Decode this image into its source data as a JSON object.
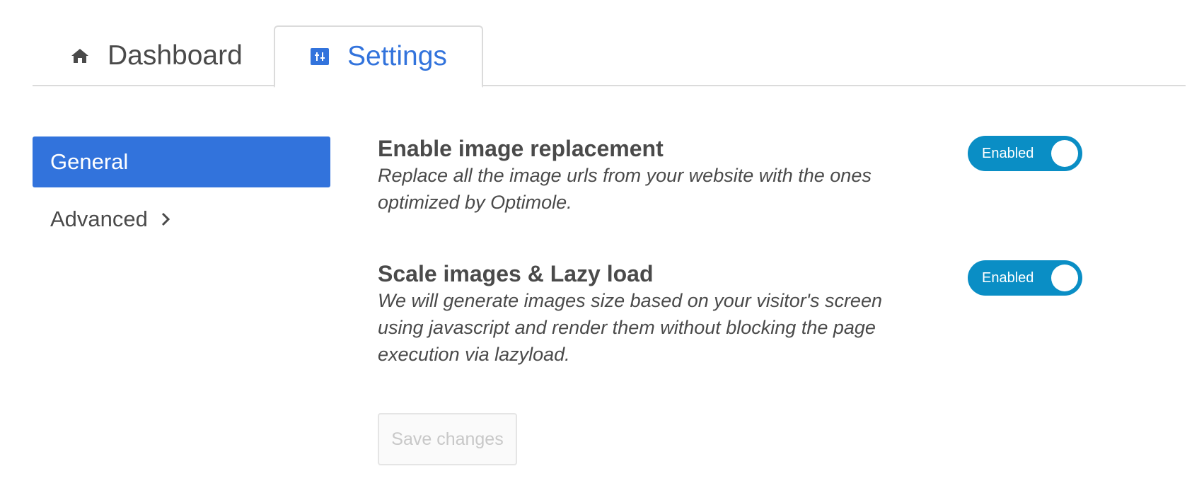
{
  "tabs": [
    {
      "label": "Dashboard",
      "icon": "home-icon"
    },
    {
      "label": "Settings",
      "icon": "sliders-icon",
      "active": true
    }
  ],
  "menu": [
    {
      "label": "General",
      "active": true
    },
    {
      "label": "Advanced",
      "icon": "chevron-right-icon"
    }
  ],
  "fields": [
    {
      "title": "Enable image replacement",
      "description": "Replace all the image urls from your website with the ones optimized by Optimole.",
      "toggle": "Enabled"
    },
    {
      "title": "Scale images & Lazy load",
      "description": "We will generate images size based on your visitor's screen using javascript and render them without blocking the page execution via lazyload.",
      "toggle": "Enabled"
    }
  ],
  "save_button": "Save changes",
  "colors": {
    "accent": "#3273dc",
    "toggle": "#0a8ec5",
    "text": "#4a4a4a"
  }
}
